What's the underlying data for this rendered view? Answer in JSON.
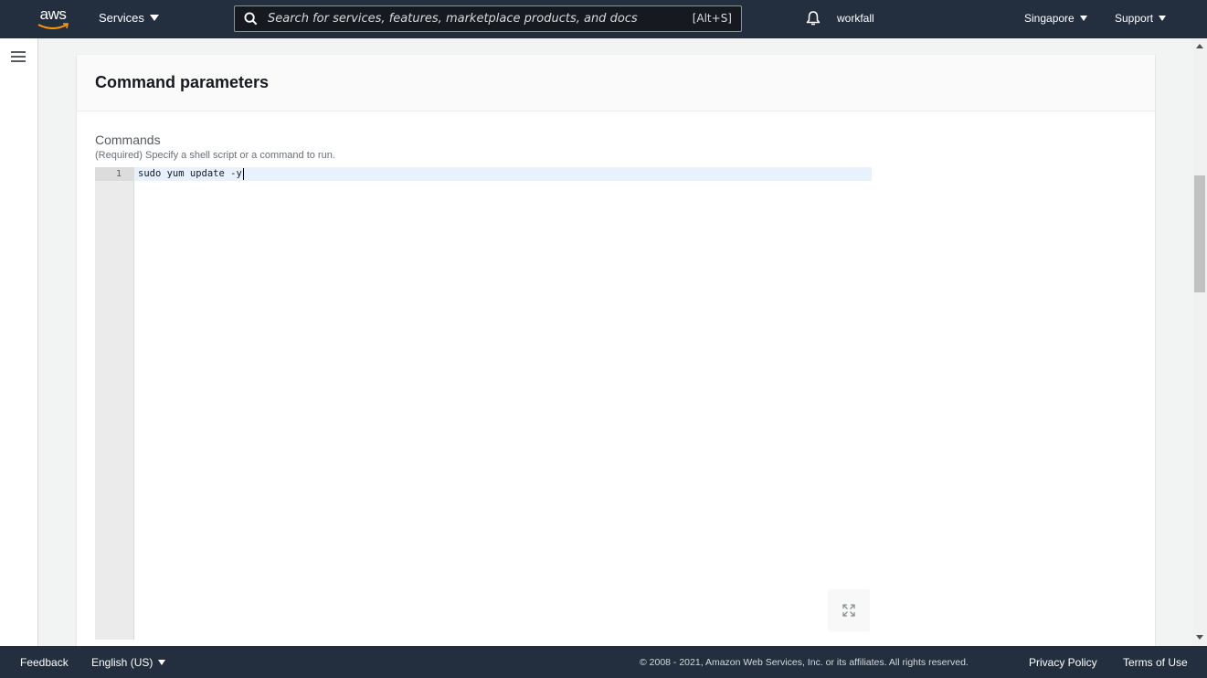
{
  "topnav": {
    "logo_text": "aws",
    "services_label": "Services",
    "search_placeholder": "Search for services, features, marketplace products, and docs",
    "search_value": "",
    "search_shortcut": "[Alt+S]",
    "account_name": "workfall",
    "region_label": "Singapore",
    "support_label": "Support"
  },
  "panel": {
    "title": "Command parameters",
    "commands_label": "Commands",
    "commands_description": "(Required) Specify a shell script or a command to run.",
    "editor": {
      "line_number": "1",
      "code": "sudo yum update -y"
    }
  },
  "footer": {
    "feedback": "Feedback",
    "language": "English (US)",
    "copyright": "© 2008 - 2021, Amazon Web Services, Inc. or its affiliates. All rights reserved.",
    "privacy": "Privacy Policy",
    "terms": "Terms of Use"
  },
  "colors": {
    "nav_bg": "#232f3e",
    "page_bg": "#f2f3f3",
    "panel_bg": "#ffffff",
    "editor_active_line": "#e8f2ff",
    "aws_smile": "#ff9900"
  },
  "icons": {
    "logo": "aws-logo",
    "search": "search-icon",
    "notifications": "bell-icon",
    "menu": "hamburger-icon",
    "expand": "expand-icon"
  }
}
